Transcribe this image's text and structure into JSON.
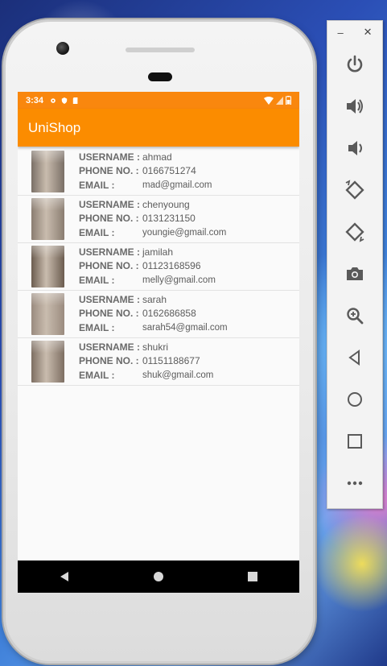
{
  "status_bar": {
    "time": "3:34"
  },
  "app": {
    "title": "UniShop"
  },
  "labels": {
    "username": "USERNAME :",
    "phone": "PHONE NO. :",
    "email": "EMAIL :"
  },
  "users": [
    {
      "username": "ahmad",
      "phone": "0166751274",
      "email": "mad@gmail.com",
      "thumb_color": "#7a6f66"
    },
    {
      "username": "chenyoung",
      "phone": "0131231150",
      "email": "youngie@gmail.com",
      "thumb_color": "#8a7d71"
    },
    {
      "username": "jamilah",
      "phone": "01123168596",
      "email": "melly@gmail.com",
      "thumb_color": "#6b5c4f"
    },
    {
      "username": "sarah",
      "phone": "0162686858",
      "email": "sarah54@gmail.com",
      "thumb_color": "#9a8b7f"
    },
    {
      "username": "shukri",
      "phone": "01151188677",
      "email": "shuk@gmail.com",
      "thumb_color": "#7d6e62"
    }
  ],
  "colors": {
    "status_bar": "#f9870e",
    "app_bar": "#fb8c00",
    "nav_bar": "#000000"
  },
  "emulator_tools": [
    "power-icon",
    "volume-up-icon",
    "volume-down-icon",
    "rotate-left-icon",
    "rotate-right-icon",
    "camera-icon",
    "zoom-icon",
    "back-icon",
    "home-icon",
    "overview-icon",
    "more-icon"
  ]
}
